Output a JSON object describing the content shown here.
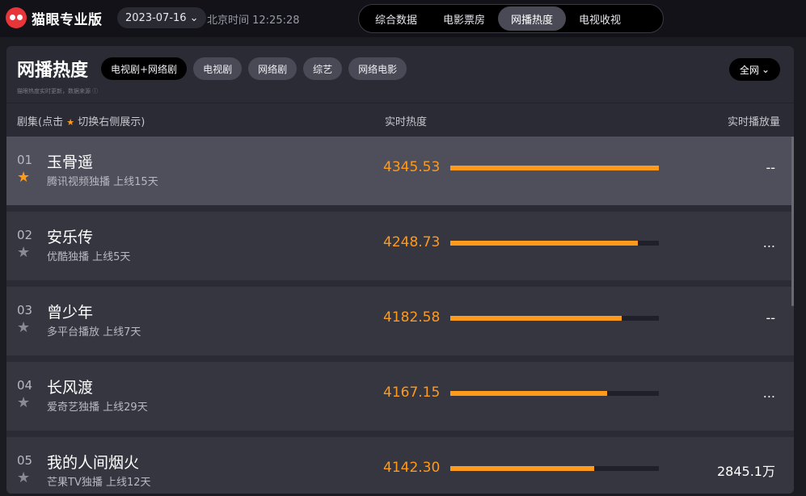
{
  "app": {
    "name": "猫眼专业版",
    "date": "2023-07-16",
    "clock": "北京时间 12:25:28"
  },
  "nav": [
    {
      "label": "综合数据",
      "active": false
    },
    {
      "label": "电影票房",
      "active": false
    },
    {
      "label": "网播热度",
      "active": true
    },
    {
      "label": "电视收视",
      "active": false
    }
  ],
  "panel": {
    "title": "网播热度",
    "subtitle": "猫眼热度实时更新，数据来源 ⓘ",
    "chips": [
      {
        "label": "电视剧+网络剧",
        "active": true
      },
      {
        "label": "电视剧",
        "active": false
      },
      {
        "label": "网络剧",
        "active": false
      },
      {
        "label": "综艺",
        "active": false
      },
      {
        "label": "网络电影",
        "active": false
      }
    ],
    "scope": "全网"
  },
  "table": {
    "col_name_prefix": "剧集(点击",
    "col_name_suffix": "切换右侧展示)",
    "col_heat": "实时热度",
    "col_play": "实时播放量",
    "rows": [
      {
        "rank": "01",
        "title": "玉骨遥",
        "platform": "腾讯视频独播",
        "days": "上线15天",
        "heat": "4345.53",
        "heat_pct": 100,
        "play": "--",
        "starred": true,
        "selected": true
      },
      {
        "rank": "02",
        "title": "安乐传",
        "platform": "优酷独播",
        "days": "上线5天",
        "heat": "4248.73",
        "heat_pct": 90,
        "play": "...",
        "starred": false,
        "selected": false
      },
      {
        "rank": "03",
        "title": "曾少年",
        "platform": "多平台播放",
        "days": "上线7天",
        "heat": "4182.58",
        "heat_pct": 82,
        "play": "--",
        "starred": false,
        "selected": false
      },
      {
        "rank": "04",
        "title": "长风渡",
        "platform": "爱奇艺独播",
        "days": "上线29天",
        "heat": "4167.15",
        "heat_pct": 75,
        "play": "...",
        "starred": false,
        "selected": false
      },
      {
        "rank": "05",
        "title": "我的人间烟火",
        "platform": "芒果TV独播",
        "days": "上线12天",
        "heat": "4142.30",
        "heat_pct": 69,
        "play": "2845.1万",
        "starred": false,
        "selected": false
      }
    ]
  }
}
